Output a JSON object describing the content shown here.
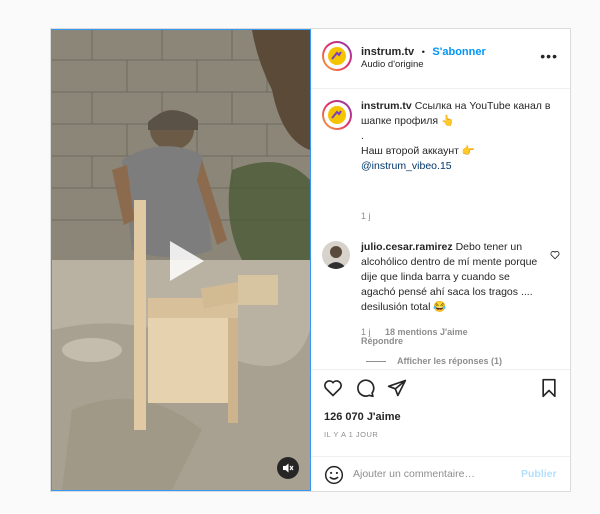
{
  "post": {
    "header": {
      "username": "instrum.tv",
      "separator": "•",
      "follow_label": "S'abonner",
      "audio_label": "Audio d'origine",
      "more_label": "•••"
    },
    "caption": {
      "username": "instrum.tv",
      "line1": "Ссылка на YouTube канал в шапке профиля 👆",
      "dot": ".",
      "line2": "Наш второй аккаунт 👉",
      "mention": "@instrum_vibeo.15",
      "time": "1 j"
    },
    "comment": {
      "username": "julio.cesar.ramirez",
      "text": "Debo tener un alcohólico dentro de mí mente porque dije que linda barra y cuando se agachó pensé ahí saca los tragos .... desilusión total 😂",
      "time": "1 j",
      "likes": "18 mentions J'aime",
      "reply_label": "Répondre",
      "show_replies": "Afficher les réponses (1)"
    },
    "likes_count": "126 070 J'aime",
    "date": "IL Y A 1 JOUR",
    "composer": {
      "placeholder": "Ajouter un commentaire…",
      "publish_label": "Publier"
    },
    "icons": [
      "heart-icon",
      "comment-icon",
      "share-icon",
      "bookmark-icon",
      "emoji-icon",
      "play-icon",
      "mute-icon",
      "like-comment-icon"
    ],
    "colors": {
      "accent": "#0095f6",
      "publish_disabled": "#b2dffc",
      "video_border": "#3897f0"
    }
  }
}
